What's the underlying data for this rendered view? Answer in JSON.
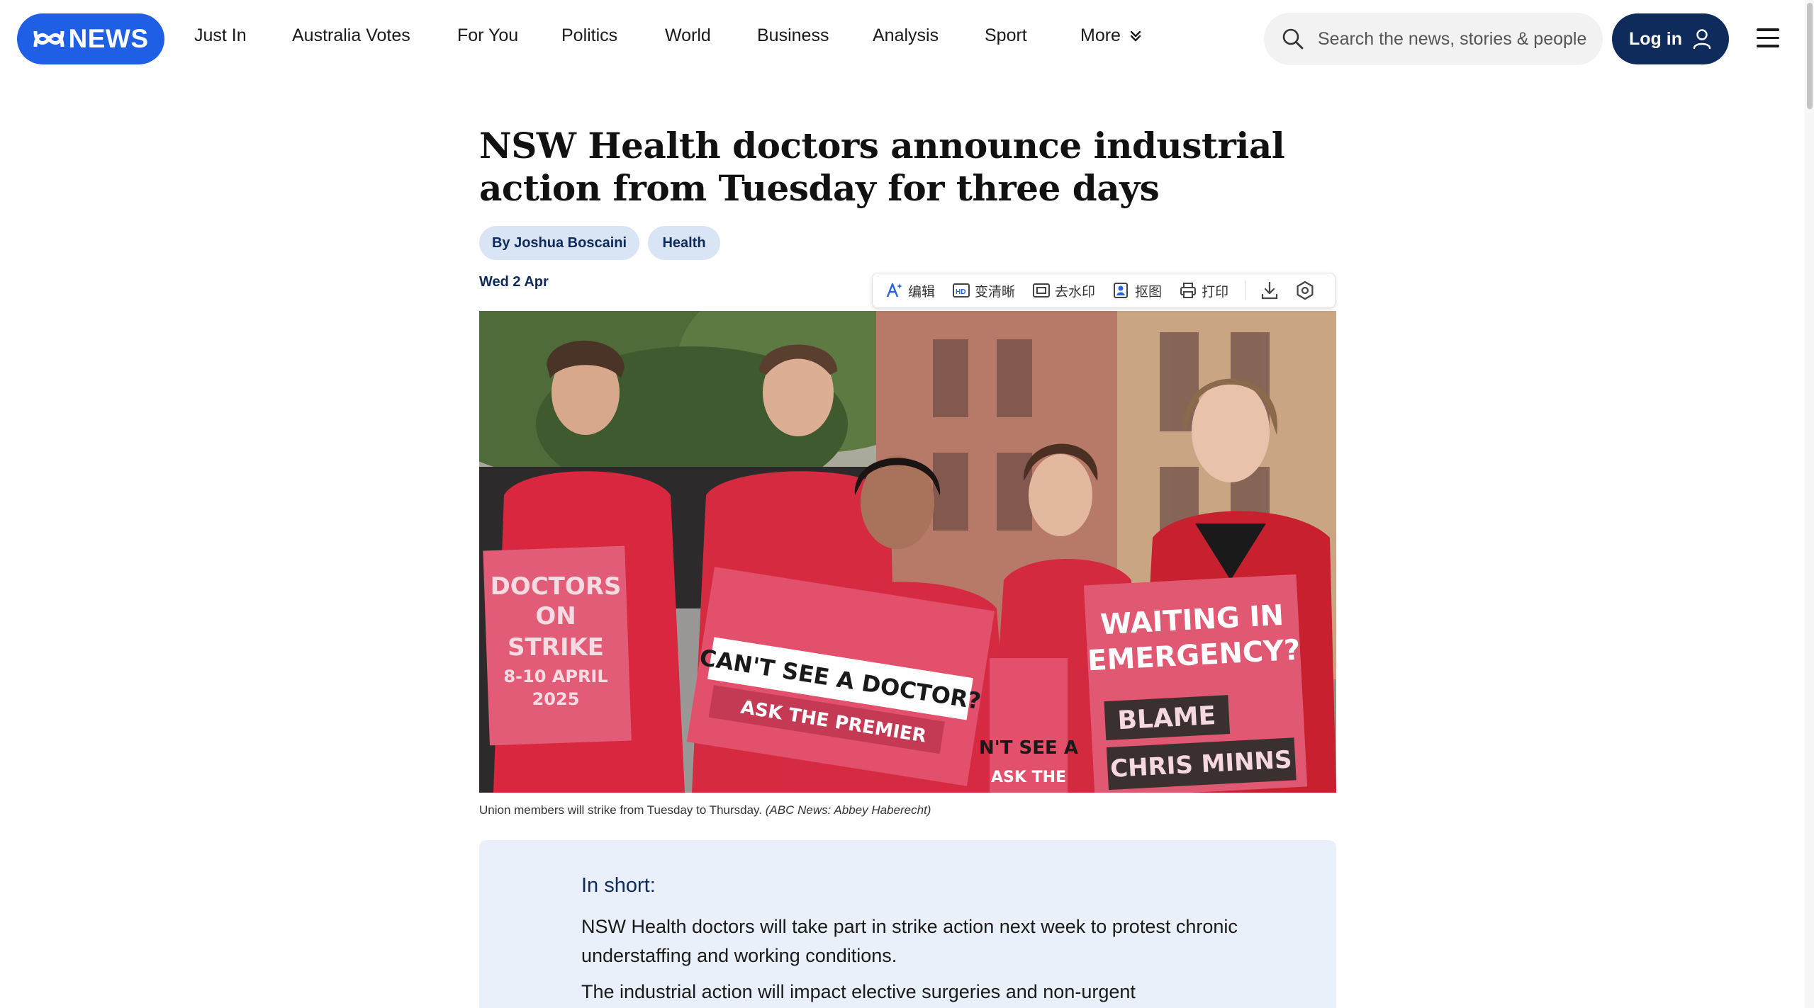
{
  "header": {
    "logo_text": "NEWS",
    "nav": [
      {
        "label": "Just In"
      },
      {
        "label": "Australia Votes"
      },
      {
        "label": "For You"
      },
      {
        "label": "Politics"
      },
      {
        "label": "World"
      },
      {
        "label": "Business"
      },
      {
        "label": "Analysis"
      },
      {
        "label": "Sport"
      },
      {
        "label": "More"
      }
    ],
    "search_placeholder": "Search the news, stories & people",
    "login_label": "Log in"
  },
  "article": {
    "headline": "NSW Health doctors announce industrial action from Tuesday for three days",
    "author_tag": "By Joshua Boscaini",
    "topic_tag": "Health",
    "date": "Wed 2 Apr",
    "caption_text": "Union members will strike from Tuesday to Thursday.",
    "caption_credit": "(ABC News: Abbey Haberecht)",
    "image_signs": {
      "left": [
        "DOCTORS",
        "ON",
        "STRIKE",
        "8-10 APRIL",
        "2025"
      ],
      "center": [
        "CAN'T SEE A DOCTOR?",
        "ASK THE PREMIER"
      ],
      "right": [
        "WAITING IN",
        "EMERGENCY?",
        "BLAME",
        "CHRIS MINNS"
      ],
      "partial": [
        "N'T SEE A",
        "ASK THE"
      ]
    }
  },
  "in_short": {
    "title": "In short:",
    "p1": "NSW Health doctors will take part in strike action next week to protest chronic understaffing and working conditions.",
    "p2": "The industrial action will impact elective surgeries and non-urgent"
  },
  "image_toolbar": {
    "items": [
      {
        "label": "编辑",
        "icon": "ai-edit-icon"
      },
      {
        "label": "变清晰",
        "icon": "hd-icon"
      },
      {
        "label": "去水印",
        "icon": "watermark-remove-icon"
      },
      {
        "label": "抠图",
        "icon": "cutout-icon"
      },
      {
        "label": "打印",
        "icon": "print-icon"
      }
    ],
    "extra_icons": [
      "download-icon",
      "settings-hex-icon"
    ]
  },
  "colors": {
    "brand_blue": "#1f5fe6",
    "navy": "#0e2b5c",
    "tag_bg": "#d9e4f5",
    "inshort_bg": "#e9f0f9",
    "sign_pink": "#e0506e"
  }
}
